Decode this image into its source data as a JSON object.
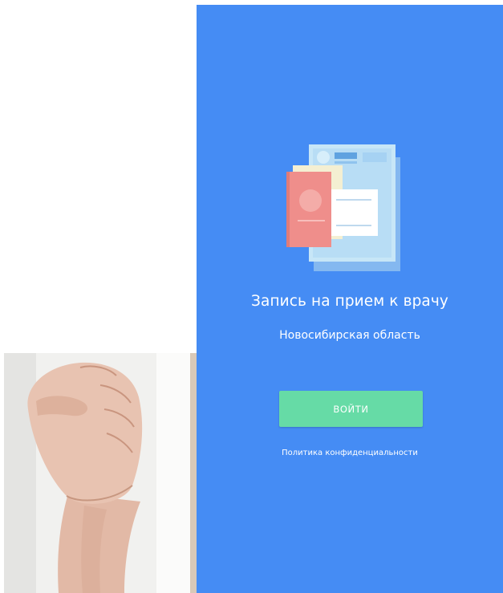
{
  "app": {
    "title": "Запись на прием к врачу",
    "region": "Новосибирская область",
    "login_label": "ВОЙТИ",
    "privacy_label": "Политика конфиденциальности"
  },
  "colors": {
    "screen_background": "#458CF4",
    "login_button": "#66DBA6",
    "text": "#FFFFFF"
  },
  "icons": {
    "illustration": "medical-documents-illustration",
    "photo": "raised-fist-photo"
  }
}
